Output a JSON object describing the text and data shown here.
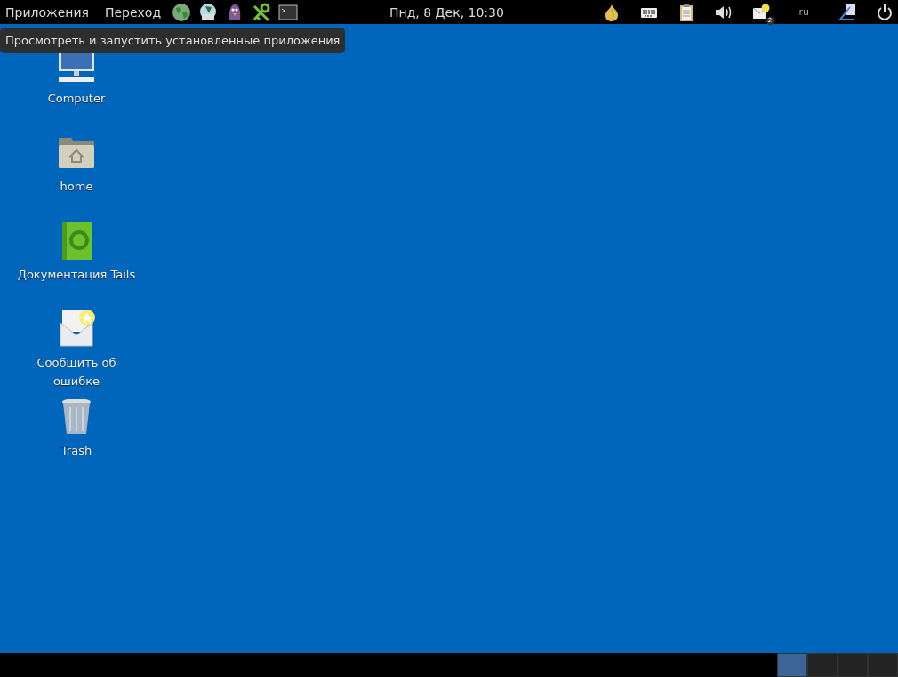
{
  "top_bar": {
    "menus": [
      {
        "label": "Приложения"
      },
      {
        "label": "Переход"
      }
    ],
    "launchers": [
      {
        "kind": "globe"
      },
      {
        "kind": "mail"
      },
      {
        "kind": "bird"
      },
      {
        "kind": "key"
      },
      {
        "kind": "terminal"
      }
    ],
    "clock": "Пнд,  8 Дек, 10:30",
    "tray": [
      {
        "kind": "onion"
      },
      {
        "kind": "keyboard"
      },
      {
        "kind": "clipboard"
      },
      {
        "kind": "volume"
      },
      {
        "kind": "notification",
        "count": "2"
      },
      {
        "kind": "layout",
        "label": "ru"
      },
      {
        "kind": "user"
      },
      {
        "kind": "power"
      }
    ]
  },
  "tooltip": "Просмотреть и запустить установленные приложения",
  "desktop_icons": [
    {
      "kind": "computer",
      "label_lines": [
        "Computer"
      ]
    },
    {
      "kind": "home",
      "label_lines": [
        "home"
      ]
    },
    {
      "kind": "book",
      "label_lines": [
        "Документация Tails"
      ]
    },
    {
      "kind": "report",
      "label_lines": [
        "Сообщить об",
        "ошибке"
      ]
    },
    {
      "kind": "trash",
      "label_lines": [
        "Trash"
      ]
    }
  ],
  "workspaces": [
    {
      "selected": true
    },
    {
      "selected": false
    },
    {
      "selected": false
    },
    {
      "selected": false
    }
  ]
}
